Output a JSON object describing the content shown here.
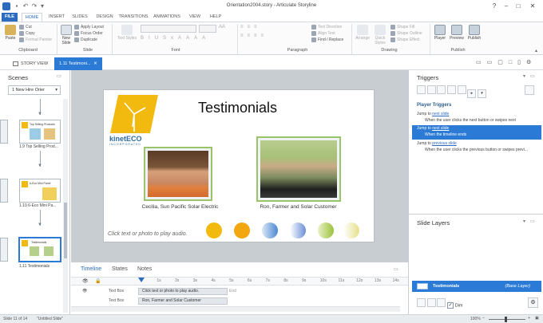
{
  "window": {
    "title": "Orientation2004.story - Articulate Storyline",
    "help_icon": "?"
  },
  "tabs": [
    "FILE",
    "HOME",
    "INSERT",
    "SLIDES",
    "DESIGN",
    "TRANSITIONS",
    "ANIMATIONS",
    "VIEW",
    "HELP"
  ],
  "ribbon": {
    "clipboard": {
      "paste": "Paste",
      "cut": "Cut",
      "copy": "Copy",
      "format_painter": "Format Painter",
      "label": "Clipboard"
    },
    "slide": {
      "new_slide": "New Slide",
      "apply_layout": "Apply Layout",
      "focus_order": "Focus Order",
      "duplicate": "Duplicate",
      "label": "Slide"
    },
    "font": {
      "text_styles": "Text Styles",
      "font_name": "",
      "font_size": "",
      "label": "Font"
    },
    "paragraph": {
      "text_direction": "Text Direction",
      "align_text": "Align Text",
      "find_replace": "Find / Replace",
      "label": "Paragraph"
    },
    "drawing": {
      "arrange": "Arrange",
      "quick_styles": "Quick Styles",
      "shape_fill": "Shape Fill",
      "shape_outline": "Shape Outline",
      "shape_effect": "Shape Effect",
      "label": "Drawing"
    },
    "publish": {
      "player": "Player",
      "preview": "Preview",
      "publish": "Publish",
      "label": "Publish"
    }
  },
  "view_tabs": {
    "story_view": "STORY VIEW",
    "slide_tab": "1.11 Testimoni..."
  },
  "scenes": {
    "title": "Scenes",
    "dropdown": "1 New Hire Orier",
    "items": [
      {
        "label": "1.9   Top Selling Prod...",
        "thumb_title": "Top Selling Products"
      },
      {
        "label": "1.10   6-Eco Mini Pa...",
        "thumb_title": "6-Eco Mini Panel"
      },
      {
        "label": "1.11 Testimonials",
        "thumb_title": "Testimonials"
      }
    ]
  },
  "slide": {
    "title": "Testimonials",
    "logo_text": "kinetECO",
    "logo_sub": "INCORPORATED",
    "people": [
      {
        "caption": "Cecilia, Sun Pacific Solar Electric"
      },
      {
        "caption": "Ron, Farmer and Solar Customer"
      }
    ],
    "hint": "Click text or photo to play audio.",
    "circles": [
      "#f2b90f",
      "#f2a60f",
      "#4b87d1",
      "#6a8fd6",
      "#9cc23a",
      "#e6e08a"
    ]
  },
  "timeline": {
    "tabs": [
      "Timeline",
      "States",
      "Notes"
    ],
    "ruler": [
      "1s",
      "2s",
      "3s",
      "4s",
      "5s",
      "6s",
      "7s",
      "8s",
      "9s",
      "10s",
      "11s",
      "12s",
      "13s",
      "14s"
    ],
    "rows": [
      {
        "name": "Text Box",
        "content": "Click text or photo to play audio.",
        "end": "End"
      },
      {
        "name": "Text Box",
        "content": "Ron, Farmer and Solar Customer"
      }
    ]
  },
  "triggers": {
    "title": "Triggers",
    "section": "Player Triggers",
    "items": [
      {
        "action": "Jump to",
        "target": "next slide",
        "condition": "When the user clicks the next button or swipes next"
      },
      {
        "action": "Jump to",
        "target": "next slide",
        "condition": "When the timeline ends"
      },
      {
        "action": "Jump to",
        "target": "previous slide",
        "condition": "When the user clicks the previous button or swipes previ..."
      }
    ]
  },
  "slide_layers": {
    "title": "Slide Layers",
    "layer_name": "Testimonials",
    "layer_tag": "(Base Layer)",
    "dim": "Dim"
  },
  "status": {
    "slide": "Slide 11 of 14",
    "name": "\"Untitled Slide\"",
    "zoom": "100%"
  },
  "colors": {
    "accent": "#2b6cbf",
    "selection": "#2b7bd6",
    "file_tab": "#2b6cbf"
  }
}
